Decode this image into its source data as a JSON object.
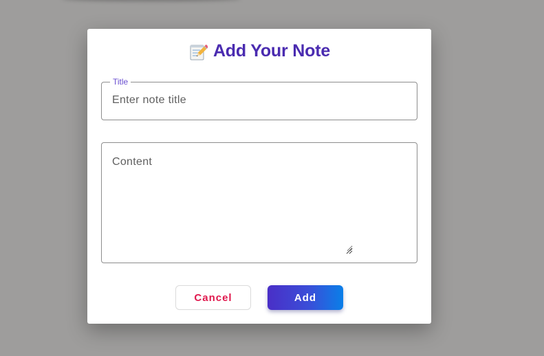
{
  "modal": {
    "title": "Add Your Note",
    "title_icon": "memo-pencil-icon",
    "title_color": "#4a2bb0"
  },
  "form": {
    "title_field": {
      "label": "Title",
      "placeholder": "Enter note title",
      "value": ""
    },
    "content_field": {
      "placeholder": "Content",
      "value": ""
    }
  },
  "actions": {
    "cancel_label": "Cancel",
    "add_label": "Add",
    "cancel_color": "#e0184d",
    "add_gradient": [
      "#4a2fc7",
      "#0a7fe8"
    ]
  }
}
